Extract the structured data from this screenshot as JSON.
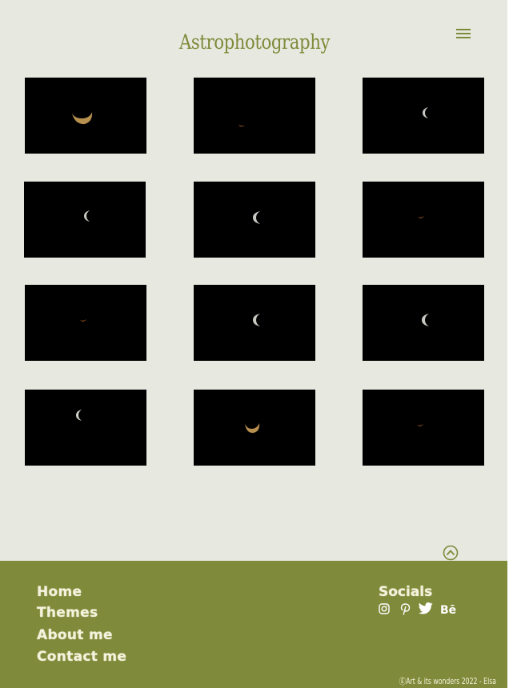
{
  "header": {
    "title": "Astrophotography",
    "menu_icon": "hamburger-icon"
  },
  "gallery": {
    "photos": [
      {
        "subject": "moon-crescent-golden"
      },
      {
        "subject": "moon-sliver-orange"
      },
      {
        "subject": "moon-crescent-grey"
      },
      {
        "subject": "moon-crescent-grey"
      },
      {
        "subject": "moon-crescent-grey"
      },
      {
        "subject": "moon-sliver-orange"
      },
      {
        "subject": "moon-sliver-orange"
      },
      {
        "subject": "moon-crescent-grey"
      },
      {
        "subject": "moon-crescent-grey"
      },
      {
        "subject": "moon-crescent-grey"
      },
      {
        "subject": "moon-crescent-golden"
      },
      {
        "subject": "moon-sliver-orange"
      }
    ]
  },
  "back_to_top_icon": "chevron-up-circle-icon",
  "footer": {
    "nav": {
      "home": "Home",
      "themes": "Themes",
      "about": "About me",
      "contact": "Contact me"
    },
    "socials": {
      "title": "Socials",
      "icons": [
        "instagram-icon",
        "pinterest-icon",
        "twitter-icon",
        "behance-icon"
      ],
      "behance_label": "Bē"
    },
    "copyright": "ⒺArt & its wonders 2022 - Elsa"
  },
  "colors": {
    "background": "#e7e8df",
    "accent": "#7f8a3a",
    "footer_text": "#f5f2dc",
    "photo_bg": "#000000"
  }
}
